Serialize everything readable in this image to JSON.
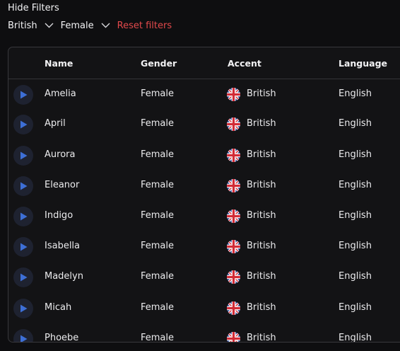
{
  "filters": {
    "toggle_label": "Hide Filters",
    "chips": [
      {
        "label": "British"
      },
      {
        "label": "Female"
      }
    ],
    "reset_label": "Reset filters"
  },
  "table": {
    "columns": [
      "Name",
      "Gender",
      "Accent",
      "Language"
    ],
    "rows": [
      {
        "name": "Amelia",
        "gender": "Female",
        "accent": "British",
        "language": "English"
      },
      {
        "name": "April",
        "gender": "Female",
        "accent": "British",
        "language": "English"
      },
      {
        "name": "Aurora",
        "gender": "Female",
        "accent": "British",
        "language": "English"
      },
      {
        "name": "Eleanor",
        "gender": "Female",
        "accent": "British",
        "language": "English"
      },
      {
        "name": "Indigo",
        "gender": "Female",
        "accent": "British",
        "language": "English"
      },
      {
        "name": "Isabella",
        "gender": "Female",
        "accent": "British",
        "language": "English"
      },
      {
        "name": "Madelyn",
        "gender": "Female",
        "accent": "British",
        "language": "English"
      },
      {
        "name": "Micah",
        "gender": "Female",
        "accent": "British",
        "language": "English"
      },
      {
        "name": "Phoebe",
        "gender": "Female",
        "accent": "British",
        "language": "English"
      }
    ]
  },
  "icons": {
    "play": "play-icon",
    "flag": "uk-flag-icon",
    "chevron": "chevron-down-icon"
  },
  "colors": {
    "background": "#0e0e10",
    "accent_play": "#3d6fd6",
    "reset": "#e2494b"
  }
}
